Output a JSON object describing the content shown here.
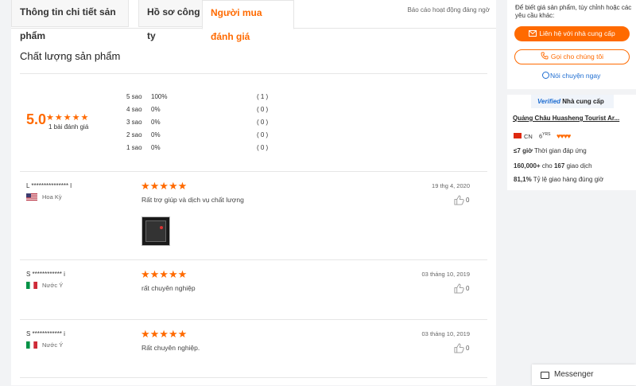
{
  "tabs": [
    {
      "label": "Thông tin chi tiết sản phẩm"
    },
    {
      "label": "Hồ sơ công ty"
    },
    {
      "label": "Người mua đánh giá"
    }
  ],
  "report_link": "Báo cáo hoạt động đáng ngờ",
  "section_title": "Chất lượng sản phẩm",
  "rating": {
    "score": "5.0",
    "stars": "★★★★★",
    "count_label": "1 bài đánh giá",
    "distribution": [
      {
        "label": "5 sao",
        "pct": "100%",
        "count": "( 1 )"
      },
      {
        "label": "4 sao",
        "pct": "0%",
        "count": "( 0 )"
      },
      {
        "label": "3 sao",
        "pct": "0%",
        "count": "( 0 )"
      },
      {
        "label": "2 sao",
        "pct": "0%",
        "count": "( 0 )"
      },
      {
        "label": "1 sao",
        "pct": "0%",
        "count": "( 0 )"
      }
    ]
  },
  "reviews": [
    {
      "name": "L *************** l",
      "country": "Hoa Kỳ",
      "stars": "★★★★★",
      "text": "Rất trợ giúp và dịch vụ chất lượng",
      "date": "19 thg 4, 2020",
      "likes": "0"
    },
    {
      "name": "S ************ i",
      "country": "Nước Ý",
      "stars": "★★★★★",
      "text": "rất chuyên nghiệp",
      "date": "03 tháng 10, 2019",
      "likes": "0"
    },
    {
      "name": "S ************ i",
      "country": "Nước Ý",
      "stars": "★★★★★",
      "text": "Rất chuyên nghiệp.",
      "date": "03 tháng 10, 2019",
      "likes": "0"
    }
  ],
  "contact": {
    "description": "Để biết giá sản phẩm, tùy chỉnh hoặc các yêu cầu khác:",
    "primary_button": "Liên hệ với nhà cung cấp",
    "call_button": "Gọi cho chúng tôi",
    "chat_link": "Nói chuyện ngay"
  },
  "supplier": {
    "verified": "Verified",
    "verified_label": "Nhà cung cấp",
    "company": "Quảng Châu Huasheng Tourist Ar...",
    "country": "CN",
    "years": "6",
    "years_unit": "YRS",
    "diamonds": "♥♥♥♥",
    "response_value": "≤7 giờ",
    "response_label": "Thời gian đáp ứng",
    "orders_value": "160,000+",
    "orders_mid": "cho",
    "orders_count": "167",
    "orders_label": "giao dịch",
    "ontime_value": "81,1%",
    "ontime_label": "Tỷ lệ giao hàng đúng giờ"
  },
  "messenger_label": "Messenger",
  "colors": {
    "accent": "#ff6a00",
    "link": "#1e6dd1"
  }
}
